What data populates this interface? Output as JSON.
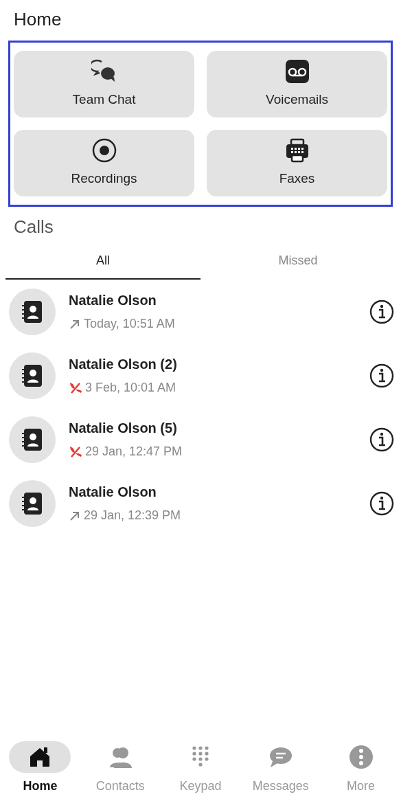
{
  "title": "Home",
  "tiles": [
    {
      "label": "Team Chat",
      "kind": "chat"
    },
    {
      "label": "Voicemails",
      "kind": "voicemail"
    },
    {
      "label": "Recordings",
      "kind": "record"
    },
    {
      "label": "Faxes",
      "kind": "fax"
    }
  ],
  "calls_title": "Calls",
  "tabs": [
    {
      "label": "All",
      "selected": true
    },
    {
      "label": "Missed",
      "selected": false
    }
  ],
  "calls": [
    {
      "name": "Natalie Olson",
      "kind": "outgoing",
      "time": "Today, 10:51 AM"
    },
    {
      "name": "Natalie Olson (2)",
      "kind": "missed",
      "time": "3 Feb, 10:01 AM"
    },
    {
      "name": "Natalie Olson (5)",
      "kind": "missed",
      "time": "29 Jan, 12:47 PM"
    },
    {
      "name": "Natalie Olson",
      "kind": "outgoing",
      "time": "29 Jan, 12:39 PM"
    }
  ],
  "nav": [
    {
      "label": "Home",
      "kind": "home",
      "selected": true
    },
    {
      "label": "Contacts",
      "kind": "contacts",
      "selected": false
    },
    {
      "label": "Keypad",
      "kind": "keypad",
      "selected": false
    },
    {
      "label": "Messages",
      "kind": "messages",
      "selected": false
    },
    {
      "label": "More",
      "kind": "more",
      "selected": false
    }
  ]
}
